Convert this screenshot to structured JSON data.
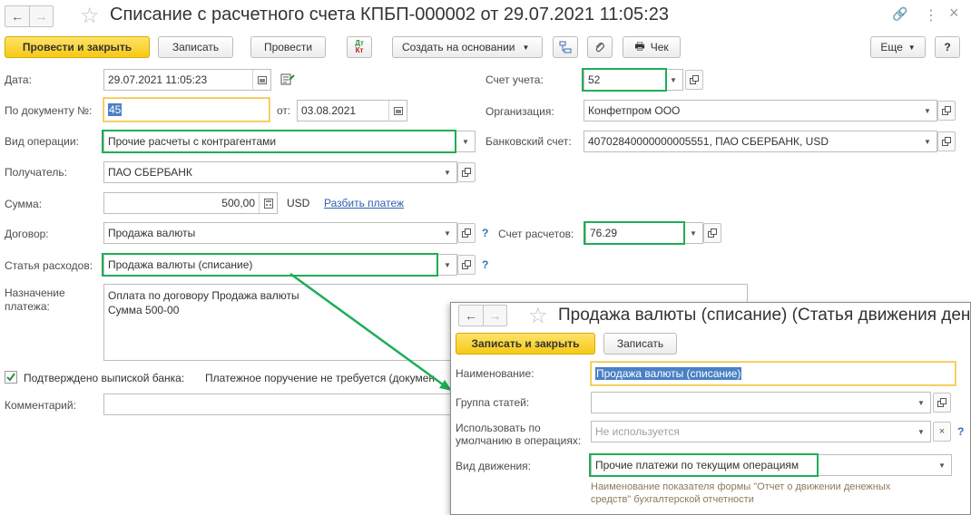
{
  "window": {
    "title": "Списание с расчетного счета КПБП-000002 от 29.07.2021 11:05:23",
    "nav_back": "←",
    "nav_forward": "→",
    "star": "☆",
    "ctrl_link": "🔗",
    "ctrl_menu": "⋮",
    "ctrl_close": "×"
  },
  "toolbar": {
    "post_close": "Провести и закрыть",
    "save": "Записать",
    "post": "Провести",
    "dt_top": "Дт",
    "dt_bottom": "Кт",
    "create_based": "Создать на основании",
    "check": "Чек",
    "more": "Еще",
    "help": "?"
  },
  "form": {
    "date_label": "Дата:",
    "date_value": "29.07.2021 11:05:23",
    "doc_label": "По документу №:",
    "doc_value": "45",
    "from_label": "от:",
    "from_value": "03.08.2021",
    "op_label": "Вид операции:",
    "op_value": "Прочие расчеты с контрагентами",
    "recipient_label": "Получатель:",
    "recipient_value": "ПАО СБЕРБАНК",
    "sum_label": "Сумма:",
    "sum_value": "500,00",
    "currency": "USD",
    "split_link": "Разбить платеж",
    "contract_label": "Договор:",
    "contract_value": "Продажа валюты",
    "expense_label": "Статья расходов:",
    "expense_value": "Продажа валюты (списание)",
    "purpose_label_1": "Назначение",
    "purpose_label_2": "платежа:",
    "purpose_line_1": "Оплата по договору Продажа валюты",
    "purpose_line_2": "Сумма 500-00",
    "confirmed_label": "Подтверждено выпиской банка:",
    "order_note": "Платежное поручение не требуется (докумен",
    "comment_label": "Комментарий:",
    "account_label": "Счет учета:",
    "account_value": "52",
    "org_label": "Организация:",
    "org_value": "Конфетпром ООО",
    "bank_label": "Банковский счет:",
    "bank_value": "40702840000000005551, ПАО СБЕРБАНК, USD",
    "settle_label": "Счет расчетов:",
    "settle_value": "76.29",
    "help_mark": "?"
  },
  "popup": {
    "title": "Продажа валюты (списание) (Статья движения денеж",
    "save_close": "Записать и закрыть",
    "save": "Записать",
    "name_label": "Наименование:",
    "name_value": "Продажа валюты (списание)",
    "group_label": "Группа статей:",
    "group_value": "",
    "default_label_1": "Использовать по",
    "default_label_2": "умолчанию в операциях:",
    "default_value": "Не используется",
    "move_label": "Вид движения:",
    "move_value": "Прочие платежи по текущим операциям",
    "note_1": "Наименование показателя формы \"Отчет о движении денежных",
    "note_2": "средств\" бухгалтерской отчетности",
    "help_mark": "?"
  },
  "colors": {
    "highlight": "#1fad57",
    "primary_button": "#f6c915",
    "link": "#2f5fae"
  }
}
